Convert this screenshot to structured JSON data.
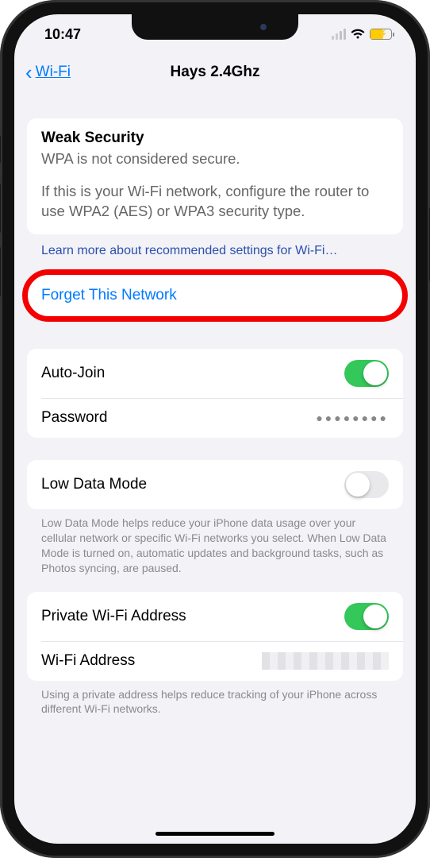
{
  "status": {
    "time": "10:47"
  },
  "nav": {
    "back": "Wi-Fi",
    "title": "Hays 2.4Ghz"
  },
  "weak": {
    "title": "Weak Security",
    "subtitle": "WPA is not considered secure.",
    "desc": "If this is your Wi-Fi network, configure the router to use WPA2 (AES) or WPA3 security type.",
    "learn": "Learn more about recommended settings for Wi-Fi…"
  },
  "forget": {
    "label": "Forget This Network"
  },
  "settings": {
    "autojoin": "Auto-Join",
    "password": "Password",
    "password_value": "●●●●●●●●"
  },
  "lowdata": {
    "label": "Low Data Mode",
    "desc": "Low Data Mode helps reduce your iPhone data usage over your cellular network or specific Wi-Fi networks you select. When Low Data Mode is turned on, automatic updates and background tasks, such as Photos syncing, are paused."
  },
  "privacy": {
    "private_label": "Private Wi-Fi Address",
    "addr_label": "Wi-Fi Address",
    "desc": "Using a private address helps reduce tracking of your iPhone across different Wi-Fi networks."
  }
}
